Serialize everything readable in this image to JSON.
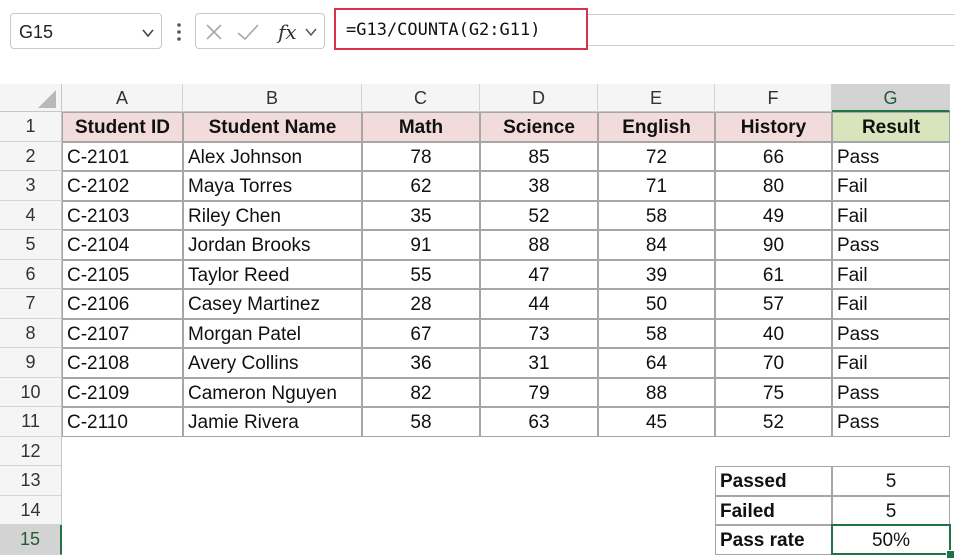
{
  "name_box": {
    "value": "G15"
  },
  "formula": {
    "text": "=G13/COUNTA(G2:G11)"
  },
  "columns": [
    "A",
    "B",
    "C",
    "D",
    "E",
    "F",
    "G"
  ],
  "rows": [
    "1",
    "2",
    "3",
    "4",
    "5",
    "6",
    "7",
    "8",
    "9",
    "10",
    "11",
    "12",
    "13",
    "14",
    "15"
  ],
  "table": {
    "headers": [
      "Student ID",
      "Student Name",
      "Math",
      "Science",
      "English",
      "History",
      "Result"
    ],
    "rows": [
      [
        "C-2101",
        "Alex Johnson",
        "78",
        "85",
        "72",
        "66",
        "Pass"
      ],
      [
        "C-2102",
        "Maya Torres",
        "62",
        "38",
        "71",
        "80",
        "Fail"
      ],
      [
        "C-2103",
        "Riley Chen",
        "35",
        "52",
        "58",
        "49",
        "Fail"
      ],
      [
        "C-2104",
        "Jordan Brooks",
        "91",
        "88",
        "84",
        "90",
        "Pass"
      ],
      [
        "C-2105",
        "Taylor Reed",
        "55",
        "47",
        "39",
        "61",
        "Fail"
      ],
      [
        "C-2106",
        "Casey Martinez",
        "28",
        "44",
        "50",
        "57",
        "Fail"
      ],
      [
        "C-2107",
        "Morgan Patel",
        "67",
        "73",
        "58",
        "40",
        "Pass"
      ],
      [
        "C-2108",
        "Avery Collins",
        "36",
        "31",
        "64",
        "70",
        "Fail"
      ],
      [
        "C-2109",
        "Cameron Nguyen",
        "82",
        "79",
        "88",
        "75",
        "Pass"
      ],
      [
        "C-2110",
        "Jamie Rivera",
        "58",
        "63",
        "45",
        "52",
        "Pass"
      ]
    ]
  },
  "summary": [
    {
      "label": "Passed",
      "value": "5"
    },
    {
      "label": "Failed",
      "value": "5"
    },
    {
      "label": "Pass rate",
      "value": "50%"
    }
  ],
  "colors": {
    "header_fill": "#f2dcdb",
    "result_header_fill": "#d8e4bc",
    "selection": "#217346",
    "formula_highlight": "#d7334d"
  },
  "icons": [
    "chevron-down-icon",
    "more-options-icon",
    "cancel-icon",
    "enter-icon",
    "insert-function-icon"
  ]
}
